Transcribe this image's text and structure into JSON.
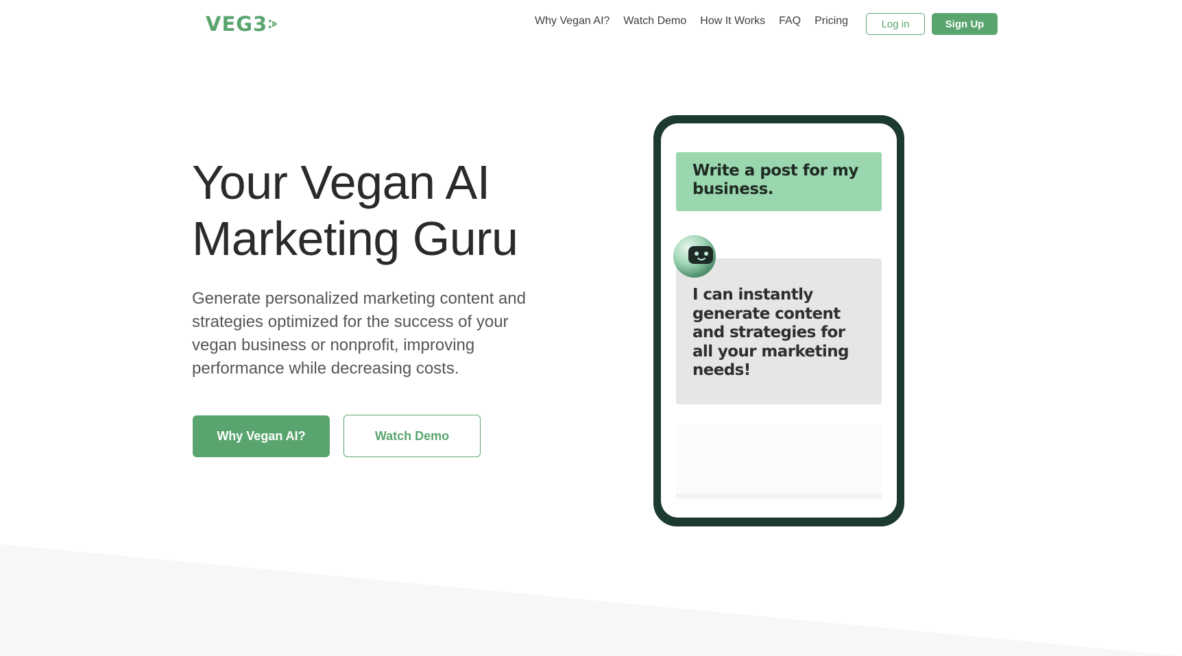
{
  "brand": {
    "logo_text": "VEG3",
    "accent": "#5aa56f",
    "dark": "#1c3a30"
  },
  "nav": {
    "links": [
      "Why Vegan AI?",
      "Watch Demo",
      "How It Works",
      "FAQ",
      "Pricing"
    ],
    "login_label": "Log in",
    "signup_label": "Sign Up"
  },
  "hero": {
    "title_line1": "Your Vegan AI",
    "title_line2": "Marketing Guru",
    "subtitle": "Generate personalized marketing content and strategies optimized for the success of your vegan business or nonprofit, improving performance while decreasing costs.",
    "primary_cta": "Why Vegan AI?",
    "secondary_cta": "Watch Demo"
  },
  "phone": {
    "user_message": "Write a post for  my business.",
    "bot_message": "I can instantly generate content and strategies for all your marketing needs!",
    "avatar_icon": "robot-icon",
    "user_bubble_color": "#9bd7ae",
    "bot_bubble_color": "#e6e6e6"
  }
}
